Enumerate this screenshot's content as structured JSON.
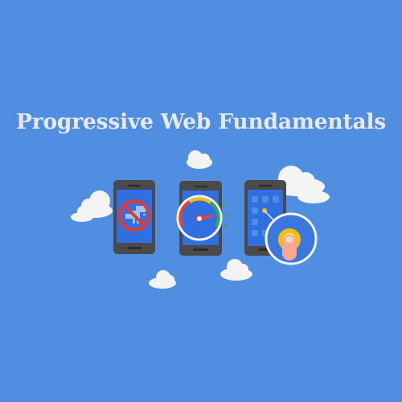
{
  "title": "Progressive Web Fundamentals",
  "colors": {
    "background": "#4f8ee0",
    "title_text": "#e8e8e8",
    "phone_body": "#4a4a4a",
    "screen_blue": "#2f6fe2",
    "cloud": "#f3f3f3",
    "no_sign_red": "#e33a2e",
    "gauge_red": "#ea4335",
    "gauge_yellow": "#fbbc05",
    "gauge_green": "#34a853",
    "touch_yellow": "#fbbc05",
    "hand_skin": "#f6a98f"
  },
  "icons": [
    "cloud-icon",
    "phone-offline-icon",
    "dinosaur-icon",
    "no-sign-icon",
    "phone-speed-icon",
    "speedometer-icon",
    "phone-touch-icon",
    "finger-tap-icon"
  ]
}
